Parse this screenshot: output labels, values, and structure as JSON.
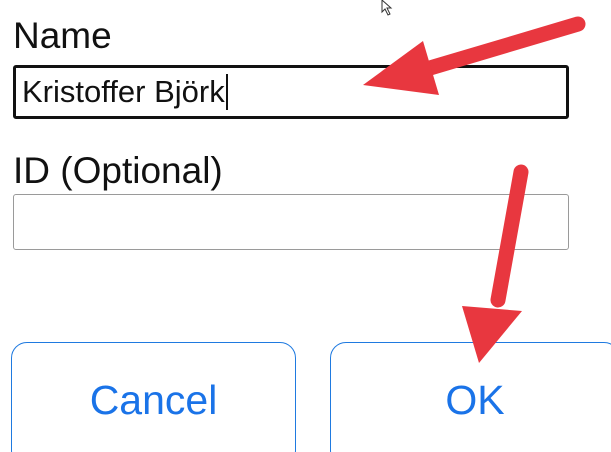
{
  "form": {
    "name_label": "Name",
    "name_value": "Kristoffer Björk",
    "id_label": "ID (Optional)",
    "id_value": ""
  },
  "buttons": {
    "cancel_label": "Cancel",
    "ok_label": "OK"
  },
  "colors": {
    "accent": "#1a73e8",
    "annotation_arrow": "#e8373f",
    "field_border_focused": "#111111",
    "field_border": "#9a9a9a"
  },
  "icons": {
    "mouse_pointer": "mouse-pointer-icon",
    "annotation_arrows": "arrow-annotation"
  }
}
